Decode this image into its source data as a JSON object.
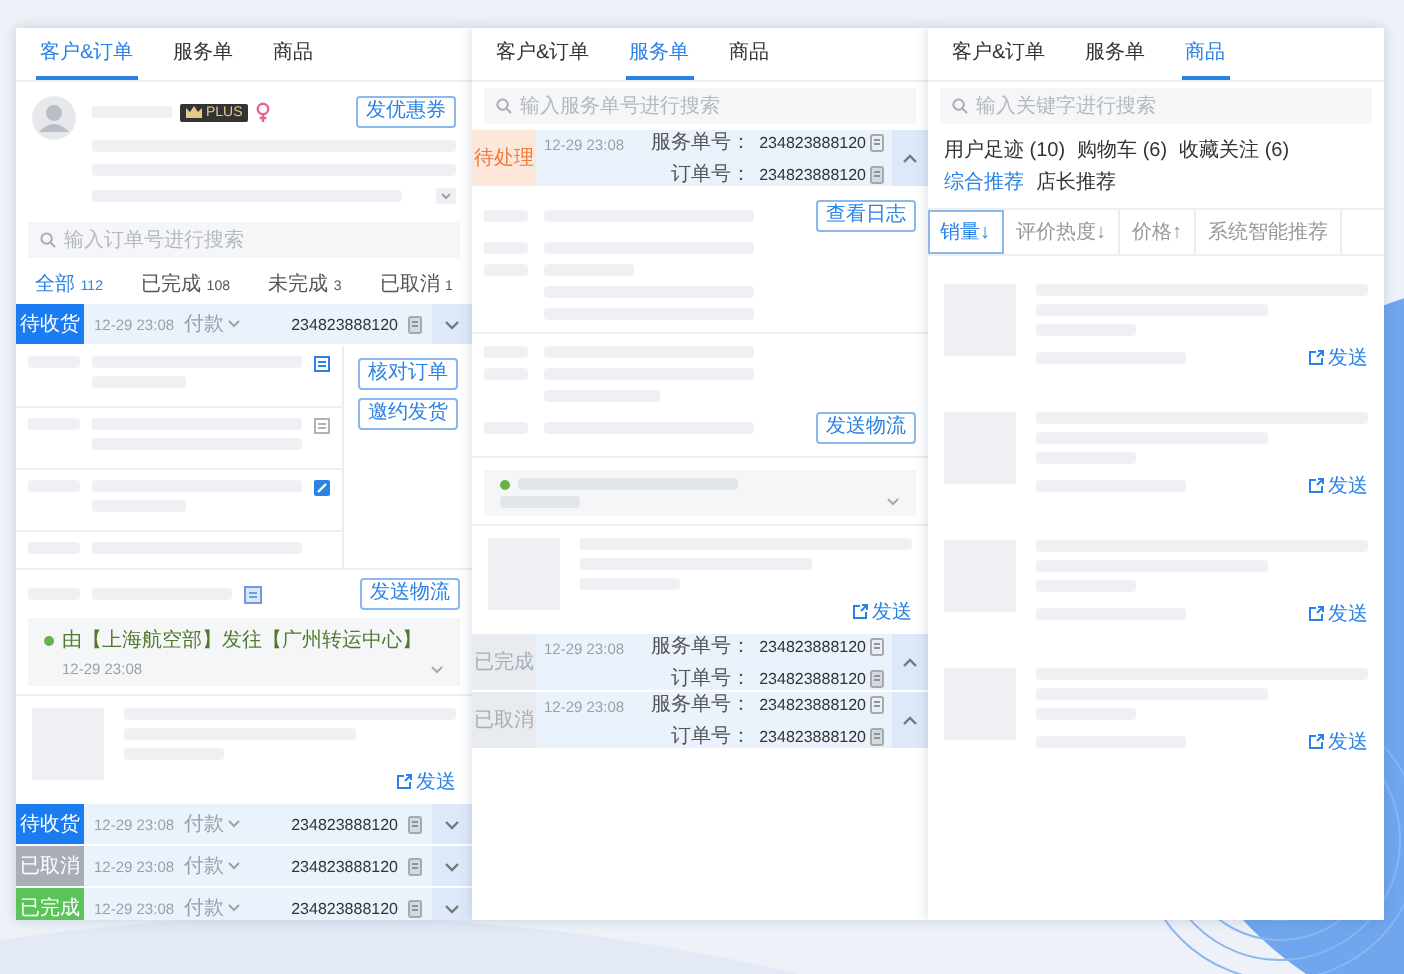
{
  "orders_panel": {
    "tabs": [
      {
        "label": "客户&订单",
        "selected": true
      },
      {
        "label": "服务单",
        "selected": false
      },
      {
        "label": "商品",
        "selected": false
      }
    ],
    "customer": {
      "badge": "PLUS",
      "button": "发优惠券"
    },
    "search": {
      "placeholder": "输入订单号进行搜索"
    },
    "filters": [
      {
        "label": "全部",
        "count": "112",
        "selected": true
      },
      {
        "label": "已完成",
        "count": "108",
        "selected": false
      },
      {
        "label": "未完成",
        "count": "3",
        "selected": false
      },
      {
        "label": "已取消",
        "count": "1",
        "selected": false
      }
    ],
    "orders": [
      {
        "status": "待收货",
        "color": "#1a7cf0",
        "time": "12-29 23:08",
        "payment": "付款",
        "number": "234823888120"
      },
      {
        "status": "待收货",
        "color": "#1a7cf0",
        "time": "12-29 23:08",
        "payment": "付款",
        "number": "234823888120"
      },
      {
        "status": "已取消",
        "color": "#a9adb5",
        "time": "12-29 23:08",
        "payment": "付款",
        "number": "234823888120"
      },
      {
        "status": "已完成",
        "color": "#5cc35a",
        "time": "12-29 23:08",
        "payment": "付款",
        "number": "234823888120"
      }
    ],
    "details": {
      "actions": [
        "核对订单",
        "邀约发货"
      ],
      "logistics_button": "发送物流",
      "logistics": {
        "text": "由【上海航空部】发往【广州转运中心】",
        "time": "12-29 23:08"
      },
      "send": "发送"
    }
  },
  "service_panel": {
    "tabs": [
      {
        "label": "客户&订单",
        "selected": false
      },
      {
        "label": "服务单",
        "selected": true
      },
      {
        "label": "商品",
        "selected": false
      }
    ],
    "search": {
      "placeholder": "输入服务单号进行搜索"
    },
    "tickets": [
      {
        "status": "待处理",
        "color": "#f07a3a",
        "time": "12-29 23:08",
        "service_label": "服务单号：",
        "service_no": "234823888120",
        "order_label": "订单号：",
        "order_no": "234823888120"
      },
      {
        "status": "已完成",
        "color": "#a9adb5",
        "time": "12-29 23:08",
        "service_label": "服务单号：",
        "service_no": "234823888120",
        "order_label": "订单号：",
        "order_no": "234823888120"
      },
      {
        "status": "已取消",
        "color": "#a9adb5",
        "time": "12-29 23:08",
        "service_label": "服务单号：",
        "service_no": "234823888120",
        "order_label": "订单号：",
        "order_no": "234823888120"
      }
    ],
    "details": {
      "log_button": "查看日志",
      "logistics_button": "发送物流",
      "send": "发送"
    }
  },
  "products_panel": {
    "tabs": [
      {
        "label": "客户&订单",
        "selected": false
      },
      {
        "label": "服务单",
        "selected": false
      },
      {
        "label": "商品",
        "selected": true
      }
    ],
    "search": {
      "placeholder": "输入关键字进行搜索"
    },
    "sources": [
      {
        "label": "用户足迹 (10)",
        "selected": false
      },
      {
        "label": "购物车 (6)",
        "selected": false
      },
      {
        "label": "收藏关注 (6)",
        "selected": false
      },
      {
        "label": "综合推荐",
        "selected": true
      },
      {
        "label": "店长推荐",
        "selected": false
      }
    ],
    "sorts": [
      {
        "label": "销量↓",
        "selected": true
      },
      {
        "label": "评价热度↓",
        "selected": false
      },
      {
        "label": "价格↑",
        "selected": false
      },
      {
        "label": "系统智能推荐",
        "selected": false
      }
    ],
    "products": [
      {
        "send": "发送"
      },
      {
        "send": "发送"
      },
      {
        "send": "发送"
      },
      {
        "send": "发送"
      }
    ]
  }
}
